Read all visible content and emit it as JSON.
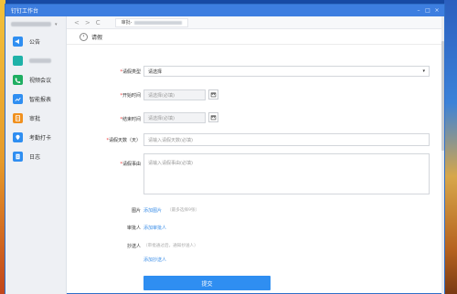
{
  "window": {
    "title": "钉钉工作台"
  },
  "sidebar": {
    "items": [
      {
        "label": "公告",
        "icon": "announcement-icon",
        "color": "#2f8ef1"
      },
      {
        "label": "",
        "icon": "blurred-app-icon",
        "color": "#1fb2a8"
      },
      {
        "label": "视频会议",
        "icon": "video-meeting-icon",
        "color": "#1fae62"
      },
      {
        "label": "智能报表",
        "icon": "report-icon",
        "color": "#2f8ef1"
      },
      {
        "label": "审批",
        "icon": "approval-icon",
        "color": "#f0901e"
      },
      {
        "label": "考勤打卡",
        "icon": "attendance-icon",
        "color": "#2f8ef1"
      },
      {
        "label": "日志",
        "icon": "log-icon",
        "color": "#2f8ef1"
      }
    ]
  },
  "navbar": {
    "back_glyph": "<",
    "forward_glyph": ">",
    "refresh_glyph": "C",
    "tab_label": "审批-"
  },
  "page": {
    "title": "请假"
  },
  "form": {
    "leave_type": {
      "label": "请假类型",
      "value": "请选择"
    },
    "start_time": {
      "label": "开始时间",
      "placeholder": "请选择(必填)"
    },
    "end_time": {
      "label": "结束时间",
      "placeholder": "请选择(必填)"
    },
    "leave_days": {
      "label": "请假天数（天）",
      "placeholder": "请输入请假天数(必填)"
    },
    "reason": {
      "label": "请假事由",
      "placeholder": "请输入请假事由(必填)"
    },
    "image": {
      "label": "图片",
      "link": "添加图片",
      "hint": "（最多选择9张）"
    },
    "approver": {
      "label": "审批人",
      "link": "添加审批人"
    },
    "cc": {
      "label": "抄送人",
      "hint": "（审批通过后，通知抄送人）",
      "link": "添加抄送人"
    },
    "submit": "提交"
  }
}
